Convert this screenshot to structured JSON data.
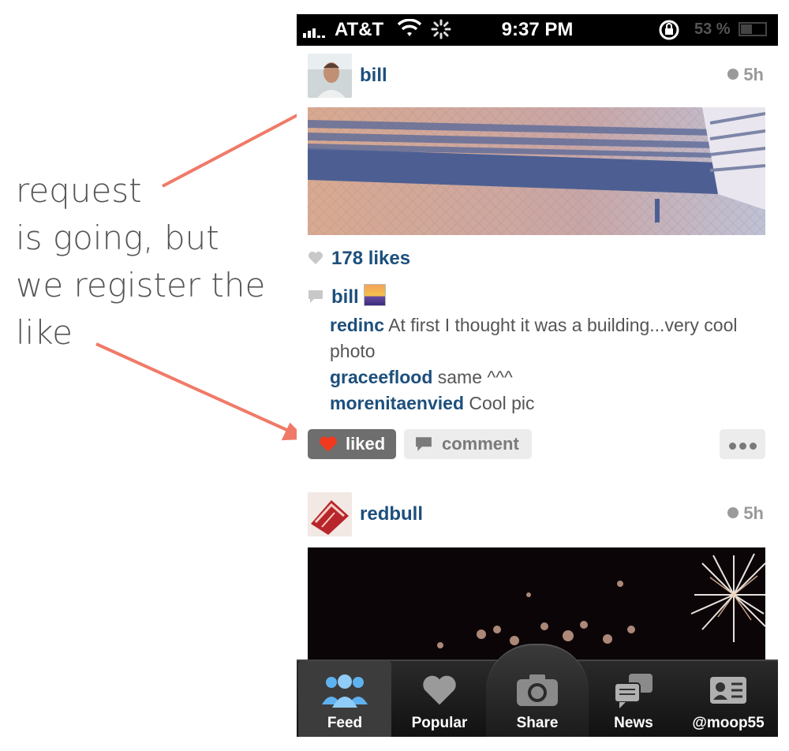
{
  "annotation": {
    "lines": [
      "request",
      "is going, but",
      "we register the",
      "like"
    ],
    "color": "#f07a68"
  },
  "status_bar": {
    "carrier": "AT&T",
    "time": "9:37 PM",
    "battery": "53 %"
  },
  "posts": [
    {
      "username": "bill",
      "time_ago": "5h",
      "likes": "178 likes",
      "caption_author": "bill",
      "comments": [
        {
          "author": "redinc",
          "text": "At first I thought it was a building...very cool photo"
        },
        {
          "author": "graceeflood",
          "text": "same ^^^"
        },
        {
          "author": "morenitaenvied",
          "text": "Cool pic"
        }
      ],
      "actions": {
        "liked": "liked",
        "comment": "comment"
      }
    },
    {
      "username": "redbull",
      "time_ago": "5h"
    }
  ],
  "tabbar": {
    "tabs": [
      "Feed",
      "Popular",
      "Share",
      "News",
      "@moop55"
    ],
    "active": "Feed"
  },
  "colors": {
    "username": "#1d4f7c",
    "liked_heart": "#f0391e",
    "arrow": "#f07a68"
  }
}
